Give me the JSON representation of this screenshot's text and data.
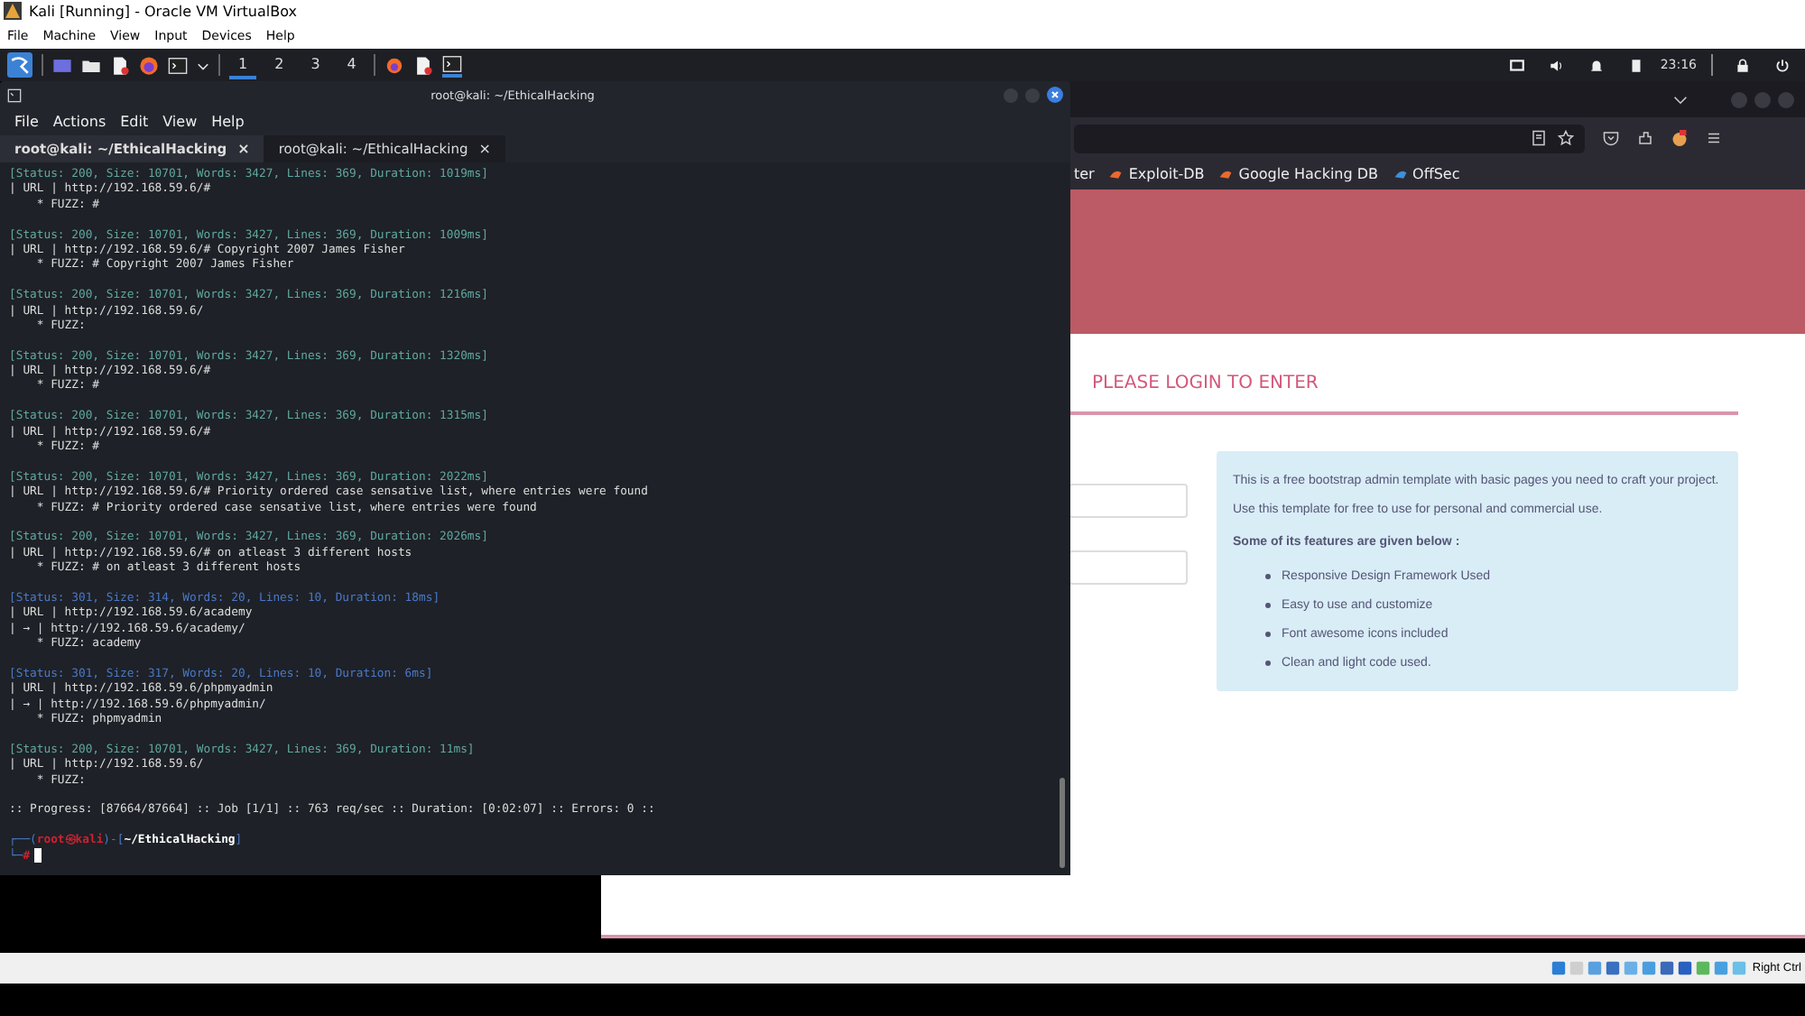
{
  "window": {
    "title": "Kali [Running] - Oracle VM VirtualBox"
  },
  "menu": [
    "File",
    "Machine",
    "View",
    "Input",
    "Devices",
    "Help"
  ],
  "panel": {
    "workspaces": [
      {
        "label": "1",
        "selected": true
      },
      {
        "label": "2",
        "selected": false
      },
      {
        "label": "3",
        "selected": false
      },
      {
        "label": "4",
        "selected": false
      }
    ],
    "time": "23:16"
  },
  "browser": {
    "bookmarks": [
      {
        "label": "ter",
        "kind": "plain"
      },
      {
        "label": "Exploit-DB",
        "kind": "exploit"
      },
      {
        "label": "Google Hacking DB",
        "kind": "exploit"
      },
      {
        "label": "OffSec",
        "kind": "offsec"
      }
    ],
    "page": {
      "heading": "PLEASE LOGIN TO ENTER",
      "info": "This is a free bootstrap admin template with basic pages you need to craft your project. Use this template for free to use for personal and commercial use.",
      "features_title": "Some of its features are given below :",
      "features": [
        "Responsive Design Framework Used",
        "Easy to use and customize",
        "Font awesome icons included",
        "Clean and light code used."
      ]
    }
  },
  "terminal": {
    "title": "root@kali: ~/EthicalHacking",
    "menu": [
      "File",
      "Actions",
      "Edit",
      "View",
      "Help"
    ],
    "tabs": [
      {
        "label": "root@kali: ~/EthicalHacking",
        "selected": true,
        "close": "×"
      },
      {
        "label": "root@kali: ~/EthicalHacking",
        "selected": false,
        "close": "×"
      }
    ],
    "results": [
      {
        "kind": "ok",
        "status": "[Status: 200, Size: 10701, Words: 3427, Lines: 369, Duration: 1019ms]",
        "lines": [
          "| URL | http://192.168.59.6/#",
          "    * FUZZ: #"
        ]
      },
      {
        "kind": "ok",
        "status": "[Status: 200, Size: 10701, Words: 3427, Lines: 369, Duration: 1009ms]",
        "lines": [
          "| URL | http://192.168.59.6/# Copyright 2007 James Fisher",
          "    * FUZZ: # Copyright 2007 James Fisher"
        ]
      },
      {
        "kind": "ok",
        "status": "[Status: 200, Size: 10701, Words: 3427, Lines: 369, Duration: 1216ms]",
        "lines": [
          "| URL | http://192.168.59.6/",
          "    * FUZZ:"
        ]
      },
      {
        "kind": "ok",
        "status": "[Status: 200, Size: 10701, Words: 3427, Lines: 369, Duration: 1320ms]",
        "lines": [
          "| URL | http://192.168.59.6/#",
          "    * FUZZ: #"
        ]
      },
      {
        "kind": "ok",
        "status": "[Status: 200, Size: 10701, Words: 3427, Lines: 369, Duration: 1315ms]",
        "lines": [
          "| URL | http://192.168.59.6/#",
          "    * FUZZ: #"
        ]
      },
      {
        "kind": "ok",
        "status": "[Status: 200, Size: 10701, Words: 3427, Lines: 369, Duration: 2022ms]",
        "lines": [
          "| URL | http://192.168.59.6/# Priority ordered case sensative list, where entries were found",
          "    * FUZZ: # Priority ordered case sensative list, where entries were found"
        ]
      },
      {
        "kind": "ok",
        "status": "[Status: 200, Size: 10701, Words: 3427, Lines: 369, Duration: 2026ms]",
        "lines": [
          "| URL | http://192.168.59.6/# on atleast 3 different hosts",
          "    * FUZZ: # on atleast 3 different hosts"
        ]
      },
      {
        "kind": "redirect",
        "status": "[Status: 301, Size: 314, Words: 20, Lines: 10, Duration: 18ms]",
        "lines": [
          "| URL | http://192.168.59.6/academy",
          "| → | http://192.168.59.6/academy/",
          "    * FUZZ: academy"
        ]
      },
      {
        "kind": "redirect",
        "status": "[Status: 301, Size: 317, Words: 20, Lines: 10, Duration: 6ms]",
        "lines": [
          "| URL | http://192.168.59.6/phpmyadmin",
          "| → | http://192.168.59.6/phpmyadmin/",
          "    * FUZZ: phpmyadmin"
        ]
      },
      {
        "kind": "ok",
        "status": "[Status: 200, Size: 10701, Words: 3427, Lines: 369, Duration: 11ms]",
        "lines": [
          "| URL | http://192.168.59.6/",
          "    * FUZZ:"
        ]
      }
    ],
    "progress": ":: Progress: [87664/87664] :: Job [1/1] :: 763 req/sec :: Duration: [0:02:07] :: Errors: 0 ::",
    "prompt": {
      "open": "┌──(",
      "user": "root㉿kali",
      "middle": ")-[",
      "path": "~/EthicalHacking",
      "close": "]",
      "second": "└─",
      "symbol": "#"
    }
  },
  "status_bar": {
    "host_key": "Right Ctrl"
  }
}
